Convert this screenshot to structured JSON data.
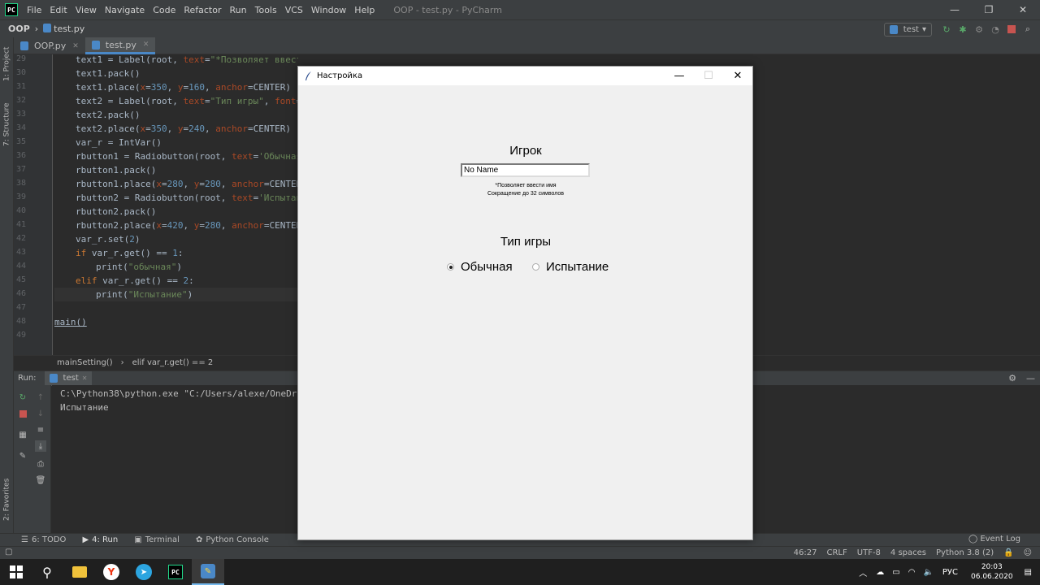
{
  "ide": {
    "logo": "PC",
    "menu": [
      "File",
      "Edit",
      "View",
      "Navigate",
      "Code",
      "Refactor",
      "Run",
      "Tools",
      "VCS",
      "Window",
      "Help"
    ],
    "window_title": "OOP - test.py - PyCharm",
    "nav": {
      "project": "OOP",
      "file": "test.py"
    },
    "run_config": "test",
    "side_tabs": [
      "1: Project",
      "7: Structure",
      "2: Favorites"
    ],
    "editor_tabs": [
      {
        "label": "OOP.py",
        "active": false
      },
      {
        "label": "test.py",
        "active": true
      }
    ],
    "line_numbers": [
      "29",
      "30",
      "31",
      "32",
      "33",
      "34",
      "35",
      "36",
      "37",
      "38",
      "39",
      "40",
      "41",
      "42",
      "43",
      "44",
      "45",
      "46",
      "47",
      "48",
      "49"
    ],
    "code_crumbs": [
      "mainSetting()",
      "elif var_r.get() == 2"
    ],
    "run_panel": {
      "label": "Run:",
      "tab": "test",
      "console": [
        "C:\\Python38\\python.exe \"C:/Users/alexe/OneDriv",
        "Испытание"
      ]
    },
    "bottom_tabs": [
      "6: TODO",
      "4: Run",
      "Terminal",
      "Python Console"
    ],
    "event_log": "Event Log",
    "status": [
      "46:27",
      "CRLF",
      "UTF-8",
      "4 spaces",
      "Python 3.8 (2)"
    ]
  },
  "taskbar": {
    "lang": "РУС",
    "time": "20:03",
    "date": "06.06.2020"
  },
  "tk_dialog": {
    "title": "Настройка",
    "player_label": "Игрок",
    "name_value": "No Name",
    "hint_line1": "*Позволяет ввести имя",
    "hint_line2": "Сокращение до 32 символов",
    "mode_label": "Тип игры",
    "radio_options": [
      {
        "label": "Обычная",
        "selected": true
      },
      {
        "label": "Испытание",
        "selected": false
      }
    ]
  },
  "colors": {
    "editor_bg": "#2b2b2b",
    "panel_bg": "#3c3f41",
    "string": "#6a8759",
    "keyword": "#cc7832",
    "number": "#6897bb",
    "param": "#aa4926"
  }
}
